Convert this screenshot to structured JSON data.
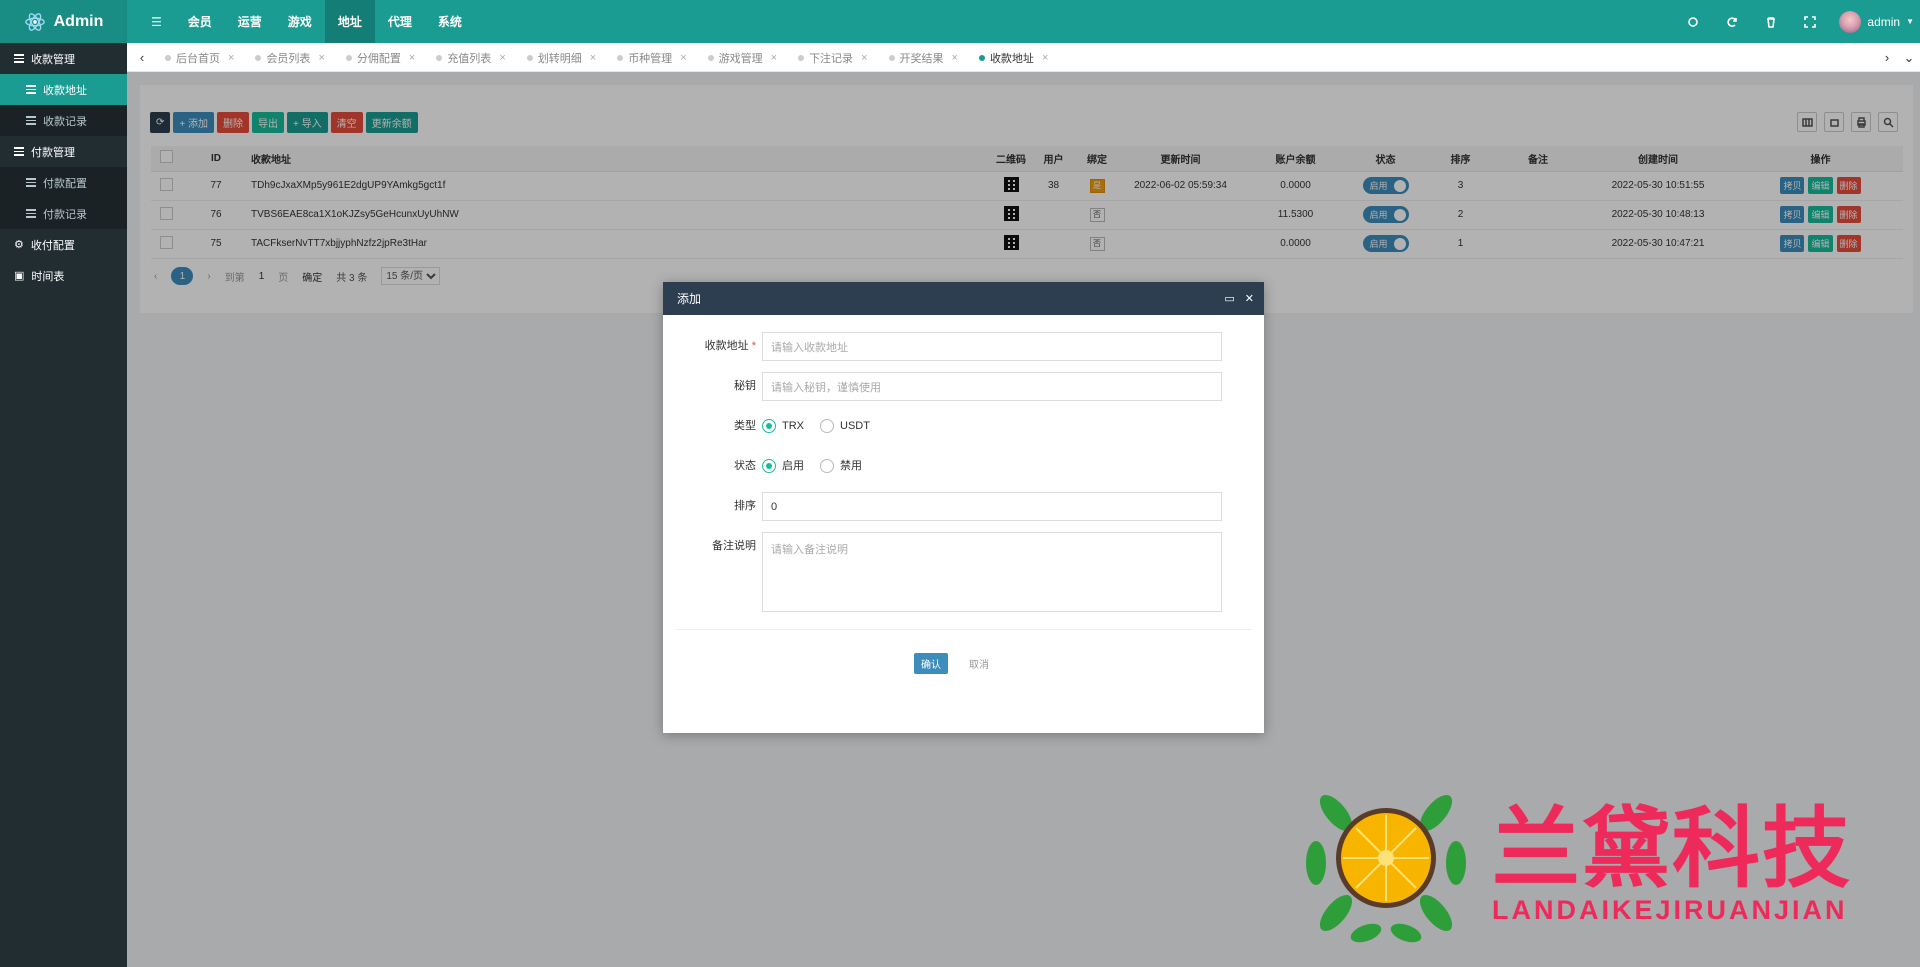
{
  "app": {
    "title": "Admin"
  },
  "topnav": [
    {
      "label": "会员"
    },
    {
      "label": "运营"
    },
    {
      "label": "游戏"
    },
    {
      "label": "地址"
    },
    {
      "label": "代理"
    },
    {
      "label": "系统"
    }
  ],
  "user": {
    "name": "admin"
  },
  "sidebar": {
    "groups": [
      {
        "label": "收款管理",
        "items": [
          {
            "label": "收款地址"
          },
          {
            "label": "收款记录"
          }
        ]
      },
      {
        "label": "付款管理",
        "items": [
          {
            "label": "付款配置"
          },
          {
            "label": "付款记录"
          }
        ]
      },
      {
        "label": "收付配置",
        "items": []
      },
      {
        "label": "时间表",
        "items": []
      }
    ]
  },
  "tabs": [
    {
      "label": "后台首页"
    },
    {
      "label": "会员列表"
    },
    {
      "label": "分佣配置"
    },
    {
      "label": "充值列表"
    },
    {
      "label": "划转明细"
    },
    {
      "label": "币种管理"
    },
    {
      "label": "游戏管理"
    },
    {
      "label": "下注记录"
    },
    {
      "label": "开奖结果"
    },
    {
      "label": "收款地址"
    }
  ],
  "toolbar": {
    "add": "+ 添加",
    "delete": "删除",
    "export": "导出",
    "import": "+ 导入",
    "clear": "清空",
    "refresh_balance": "更新余额"
  },
  "table": {
    "headers": [
      "ID",
      "收款地址",
      "二维码",
      "用户",
      "绑定",
      "更新时间",
      "账户余额",
      "状态",
      "排序",
      "备注",
      "创建时间",
      "操作"
    ],
    "rows": [
      {
        "id": "77",
        "address": "TDh9cJxaXMp5y961E2dgUP9YAmkg5gct1f",
        "user": "38",
        "bind": "是",
        "updated": "2022-06-02 05:59:34",
        "balance": "0.0000",
        "status": "启用",
        "sort": "3",
        "remark": "",
        "created": "2022-05-30 10:51:55"
      },
      {
        "id": "76",
        "address": "TVBS6EAE8ca1X1oKJZsy5GeHcunxUyUhNW",
        "user": "",
        "bind": "否",
        "updated": "",
        "balance": "11.5300",
        "status": "启用",
        "sort": "2",
        "remark": "",
        "created": "2022-05-30 10:48:13"
      },
      {
        "id": "75",
        "address": "TACFkserNvTT7xbjjyphNzfz2jpRe3tHar",
        "user": "",
        "bind": "否",
        "updated": "",
        "balance": "0.0000",
        "status": "启用",
        "sort": "1",
        "remark": "",
        "created": "2022-05-30 10:47:21"
      }
    ],
    "ops": {
      "op1": "拷贝",
      "edit": "编辑",
      "del": "删除"
    }
  },
  "pager": {
    "current": "1",
    "goto_label": "到第",
    "page_value": "1",
    "page_label": "页",
    "confirm": "确定",
    "total": "共 3 条",
    "per_page": "15 条/页"
  },
  "modal": {
    "title": "添加",
    "fields": {
      "address": {
        "label": "收款地址",
        "placeholder": "请输入收款地址"
      },
      "key": {
        "label": "秘钥",
        "placeholder": "请输入秘钥，谨慎使用"
      },
      "type": {
        "label": "类型",
        "options": [
          "TRX",
          "USDT"
        ],
        "selected": "TRX"
      },
      "status": {
        "label": "状态",
        "options": [
          "启用",
          "禁用"
        ],
        "selected": "启用"
      },
      "sort": {
        "label": "排序",
        "value": "0"
      },
      "remark": {
        "label": "备注说明",
        "placeholder": "请输入备注说明"
      }
    },
    "confirm": "确认",
    "cancel": "取消"
  },
  "watermark": {
    "cn": "兰黛科技",
    "en": "LANDAIKEJIRUANJIAN"
  },
  "colors": {
    "brand": "#1a9c92",
    "sidebar": "#222d32",
    "primary": "#3c8dbc",
    "danger": "#e74c3c",
    "watermark": "#ee2a5b"
  }
}
